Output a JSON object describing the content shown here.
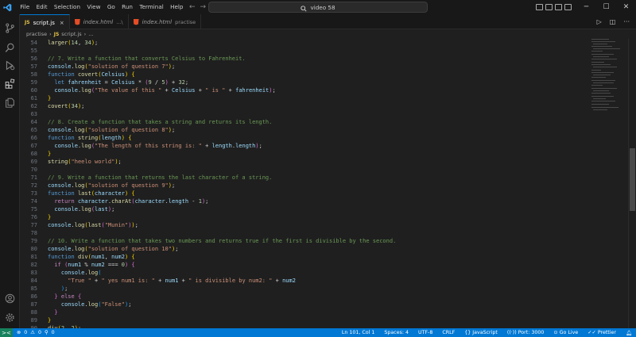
{
  "menu": [
    "File",
    "Edit",
    "Selection",
    "View",
    "Go",
    "Run",
    "Terminal",
    "Help"
  ],
  "command_center": {
    "text": "video 58"
  },
  "tabs": [
    {
      "label": "script.js",
      "desc": "",
      "type": "js",
      "active": true,
      "close": "×"
    },
    {
      "label": "index.html",
      "desc": "...\\",
      "type": "html",
      "active": false,
      "close": ""
    },
    {
      "label": "index.html",
      "desc": "practise",
      "type": "html",
      "active": false,
      "close": ""
    }
  ],
  "breadcrumb": {
    "folder": "practise",
    "file": "script.js",
    "ellipsis": "..."
  },
  "status": {
    "remote_icon": "><",
    "errors": "0",
    "warnings": "0",
    "ports": "0",
    "position": "Ln 101, Col 1",
    "spaces": "Spaces: 4",
    "encoding": "UTF-8",
    "eol": "CRLF",
    "language": "JavaScript",
    "port": "Port: 3000",
    "golive": "Go Live",
    "prettier": "Prettier"
  },
  "code_lines": [
    {
      "n": "54",
      "t": [
        [
          "larger",
          "fn"
        ],
        [
          "(",
          "br1"
        ],
        [
          "14",
          "num"
        ],
        [
          ", ",
          "txt"
        ],
        [
          "34",
          "num"
        ],
        [
          ")",
          "br1"
        ],
        [
          ";",
          "txt"
        ]
      ]
    },
    {
      "n": "55",
      "t": []
    },
    {
      "n": "56",
      "t": [
        [
          "// 7. Write a function that converts Celsius to Fahrenheit.",
          "com"
        ]
      ]
    },
    {
      "n": "57",
      "t": [
        [
          "console",
          "var"
        ],
        [
          ".",
          "txt"
        ],
        [
          "log",
          "fn"
        ],
        [
          "(",
          "br1"
        ],
        [
          "\"solution of question 7\"",
          "str"
        ],
        [
          ")",
          "br1"
        ],
        [
          ";",
          "txt"
        ]
      ]
    },
    {
      "n": "58",
      "t": [
        [
          "function ",
          "kw"
        ],
        [
          "covert",
          "fn"
        ],
        [
          "(",
          "br1"
        ],
        [
          "Celsius",
          "param"
        ],
        [
          ") ",
          "br1"
        ],
        [
          "{",
          "br1"
        ]
      ]
    },
    {
      "n": "59",
      "t": [
        [
          "  let ",
          "kw"
        ],
        [
          "fahrenheit",
          "var"
        ],
        [
          " = ",
          "txt"
        ],
        [
          "Celsius",
          "var"
        ],
        [
          " * ",
          "txt"
        ],
        [
          "(",
          "br2"
        ],
        [
          "9",
          "num"
        ],
        [
          " / ",
          "txt"
        ],
        [
          "5",
          "num"
        ],
        [
          ")",
          "br2"
        ],
        [
          " + ",
          "txt"
        ],
        [
          "32",
          "num"
        ],
        [
          ";",
          "txt"
        ]
      ]
    },
    {
      "n": "60",
      "t": [
        [
          "  console",
          "var"
        ],
        [
          ".",
          "txt"
        ],
        [
          "log",
          "fn"
        ],
        [
          "(",
          "br2"
        ],
        [
          "\"The value of this \"",
          "str"
        ],
        [
          " + ",
          "txt"
        ],
        [
          "Celsius",
          "var"
        ],
        [
          " + ",
          "txt"
        ],
        [
          "\" is \"",
          "str"
        ],
        [
          " + ",
          "txt"
        ],
        [
          "fahrenheit",
          "var"
        ],
        [
          ")",
          "br2"
        ],
        [
          ";",
          "txt"
        ]
      ]
    },
    {
      "n": "61",
      "t": [
        [
          "}",
          "br1"
        ]
      ]
    },
    {
      "n": "62",
      "t": [
        [
          "covert",
          "fn"
        ],
        [
          "(",
          "br1"
        ],
        [
          "34",
          "num"
        ],
        [
          ")",
          "br1"
        ],
        [
          ";",
          "txt"
        ]
      ]
    },
    {
      "n": "63",
      "t": []
    },
    {
      "n": "64",
      "t": [
        [
          "// 8. Create a function that takes a string and returns its length.",
          "com"
        ]
      ]
    },
    {
      "n": "65",
      "t": [
        [
          "console",
          "var"
        ],
        [
          ".",
          "txt"
        ],
        [
          "log",
          "fn"
        ],
        [
          "(",
          "br1"
        ],
        [
          "\"solution of question 8\"",
          "str"
        ],
        [
          ")",
          "br1"
        ],
        [
          ";",
          "txt"
        ]
      ]
    },
    {
      "n": "66",
      "t": [
        [
          "function ",
          "kw"
        ],
        [
          "string",
          "fn"
        ],
        [
          "(",
          "br1"
        ],
        [
          "length",
          "param"
        ],
        [
          ") ",
          "br1"
        ],
        [
          "{",
          "br1"
        ]
      ]
    },
    {
      "n": "67",
      "t": [
        [
          "  console",
          "var"
        ],
        [
          ".",
          "txt"
        ],
        [
          "log",
          "fn"
        ],
        [
          "(",
          "br2"
        ],
        [
          "\"The length of this string is: \"",
          "str"
        ],
        [
          " + ",
          "txt"
        ],
        [
          "length",
          "var"
        ],
        [
          ".",
          "txt"
        ],
        [
          "length",
          "var"
        ],
        [
          ")",
          "br2"
        ],
        [
          ";",
          "txt"
        ]
      ]
    },
    {
      "n": "68",
      "t": [
        [
          "}",
          "br1"
        ]
      ]
    },
    {
      "n": "69",
      "t": [
        [
          "string",
          "fn"
        ],
        [
          "(",
          "br1"
        ],
        [
          "\"heelo world\"",
          "str"
        ],
        [
          ")",
          "br1"
        ],
        [
          ";",
          "txt"
        ]
      ]
    },
    {
      "n": "70",
      "t": []
    },
    {
      "n": "71",
      "t": [
        [
          "// 9. Write a function that returns the last character of a string.",
          "com"
        ]
      ]
    },
    {
      "n": "72",
      "t": [
        [
          "console",
          "var"
        ],
        [
          ".",
          "txt"
        ],
        [
          "log",
          "fn"
        ],
        [
          "(",
          "br1"
        ],
        [
          "\"solution of question 9\"",
          "str"
        ],
        [
          ")",
          "br1"
        ],
        [
          ";",
          "txt"
        ]
      ]
    },
    {
      "n": "73",
      "t": [
        [
          "function ",
          "kw"
        ],
        [
          "last",
          "fn"
        ],
        [
          "(",
          "br1"
        ],
        [
          "character",
          "param"
        ],
        [
          ") ",
          "br1"
        ],
        [
          "{",
          "br1"
        ]
      ]
    },
    {
      "n": "74",
      "t": [
        [
          "  return ",
          "ctrl"
        ],
        [
          "character",
          "var"
        ],
        [
          ".",
          "txt"
        ],
        [
          "charAt",
          "fn"
        ],
        [
          "(",
          "br2"
        ],
        [
          "character",
          "var"
        ],
        [
          ".",
          "txt"
        ],
        [
          "length",
          "var"
        ],
        [
          " - ",
          "txt"
        ],
        [
          "1",
          "num"
        ],
        [
          ")",
          "br2"
        ],
        [
          ";",
          "txt"
        ]
      ]
    },
    {
      "n": "75",
      "t": [
        [
          "  console",
          "var"
        ],
        [
          ".",
          "txt"
        ],
        [
          "log",
          "fn"
        ],
        [
          "(",
          "br2"
        ],
        [
          "last",
          "var"
        ],
        [
          ")",
          "br2"
        ],
        [
          ";",
          "txt"
        ]
      ]
    },
    {
      "n": "76",
      "t": [
        [
          "}",
          "br1"
        ]
      ]
    },
    {
      "n": "77",
      "t": [
        [
          "console",
          "var"
        ],
        [
          ".",
          "txt"
        ],
        [
          "log",
          "fn"
        ],
        [
          "(",
          "br1"
        ],
        [
          "last",
          "fn"
        ],
        [
          "(",
          "br2"
        ],
        [
          "\"Munin\"",
          "str"
        ],
        [
          ")",
          "br2"
        ],
        [
          ")",
          "br1"
        ],
        [
          ";",
          "txt"
        ]
      ]
    },
    {
      "n": "78",
      "t": []
    },
    {
      "n": "79",
      "t": [
        [
          "// 10. Write a function that takes two numbers and returns true if the first is divisible by the second.",
          "com"
        ]
      ]
    },
    {
      "n": "80",
      "t": [
        [
          "console",
          "var"
        ],
        [
          ".",
          "txt"
        ],
        [
          "log",
          "fn"
        ],
        [
          "(",
          "br1"
        ],
        [
          "\"solution of question 10\"",
          "str"
        ],
        [
          ")",
          "br1"
        ],
        [
          ";",
          "txt"
        ]
      ]
    },
    {
      "n": "81",
      "t": [
        [
          "function ",
          "kw"
        ],
        [
          "div",
          "fn"
        ],
        [
          "(",
          "br1"
        ],
        [
          "num1",
          "param"
        ],
        [
          ", ",
          "txt"
        ],
        [
          "num2",
          "param"
        ],
        [
          ") ",
          "br1"
        ],
        [
          "{",
          "br1"
        ]
      ]
    },
    {
      "n": "82",
      "t": [
        [
          "  if ",
          "ctrl"
        ],
        [
          "(",
          "br2"
        ],
        [
          "num1",
          "var"
        ],
        [
          " % ",
          "txt"
        ],
        [
          "num2",
          "var"
        ],
        [
          " === ",
          "txt"
        ],
        [
          "0",
          "num"
        ],
        [
          ") ",
          "br2"
        ],
        [
          "{",
          "br2"
        ]
      ]
    },
    {
      "n": "83",
      "t": [
        [
          "    console",
          "var"
        ],
        [
          ".",
          "txt"
        ],
        [
          "log",
          "fn"
        ],
        [
          "(",
          "br3"
        ]
      ]
    },
    {
      "n": "84",
      "t": [
        [
          "      \"True \"",
          "str"
        ],
        [
          " + ",
          "txt"
        ],
        [
          "\" yes num1 is: \"",
          "str"
        ],
        [
          " + ",
          "txt"
        ],
        [
          "num1",
          "var"
        ],
        [
          " + ",
          "txt"
        ],
        [
          "\" is divisible by num2: \"",
          "str"
        ],
        [
          " + ",
          "txt"
        ],
        [
          "num2",
          "var"
        ]
      ]
    },
    {
      "n": "85",
      "t": [
        [
          "    )",
          "br3"
        ],
        [
          ";",
          "txt"
        ]
      ]
    },
    {
      "n": "86",
      "t": [
        [
          "  } ",
          "br2"
        ],
        [
          "else ",
          "ctrl"
        ],
        [
          "{",
          "br2"
        ]
      ]
    },
    {
      "n": "87",
      "t": [
        [
          "    console",
          "var"
        ],
        [
          ".",
          "txt"
        ],
        [
          "log",
          "fn"
        ],
        [
          "(",
          "br3"
        ],
        [
          "\"False\"",
          "str"
        ],
        [
          ")",
          "br3"
        ],
        [
          ";",
          "txt"
        ]
      ]
    },
    {
      "n": "88",
      "t": [
        [
          "  }",
          "br2"
        ]
      ]
    },
    {
      "n": "89",
      "t": [
        [
          "}",
          "br1"
        ]
      ]
    },
    {
      "n": "90",
      "t": [
        [
          "div",
          "fn"
        ],
        [
          "(",
          "br1"
        ],
        [
          "2",
          "num"
        ],
        [
          ", ",
          "txt"
        ],
        [
          "2",
          "num"
        ],
        [
          ")",
          "br1"
        ],
        [
          ";",
          "txt"
        ]
      ]
    }
  ]
}
